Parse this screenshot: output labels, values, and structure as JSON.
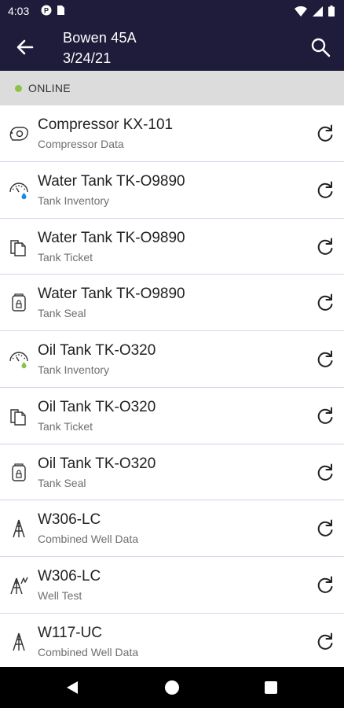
{
  "status_bar": {
    "time": "4:03"
  },
  "header": {
    "title": "Bowen 45A",
    "subtitle": "3/24/21"
  },
  "connection": {
    "label": "ONLINE",
    "color": "#8bc34a"
  },
  "items": [
    {
      "title": "Compressor KX-101",
      "subtitle": "Compressor Data",
      "icon": "compressor-icon"
    },
    {
      "title": "Water Tank TK-O9890",
      "subtitle": "Tank Inventory",
      "icon": "gauge-water-icon"
    },
    {
      "title": "Water Tank TK-O9890",
      "subtitle": "Tank Ticket",
      "icon": "ticket-icon"
    },
    {
      "title": "Water Tank TK-O9890",
      "subtitle": "Tank Seal",
      "icon": "seal-icon"
    },
    {
      "title": "Oil Tank TK-O320",
      "subtitle": "Tank Inventory",
      "icon": "gauge-oil-icon"
    },
    {
      "title": "Oil Tank TK-O320",
      "subtitle": "Tank Ticket",
      "icon": "ticket-icon"
    },
    {
      "title": "Oil Tank TK-O320",
      "subtitle": "Tank Seal",
      "icon": "seal-icon"
    },
    {
      "title": "W306-LC",
      "subtitle": "Combined Well Data",
      "icon": "well-icon"
    },
    {
      "title": "W306-LC",
      "subtitle": "Well Test",
      "icon": "well-test-icon"
    },
    {
      "title": "W117-UC",
      "subtitle": "Combined Well Data",
      "icon": "well-icon"
    }
  ],
  "colors": {
    "header_bg": "#1f1c3b",
    "divider": "#d4d4ec",
    "water_drop": "#1e88e5",
    "oil_drop": "#8bc34a"
  }
}
